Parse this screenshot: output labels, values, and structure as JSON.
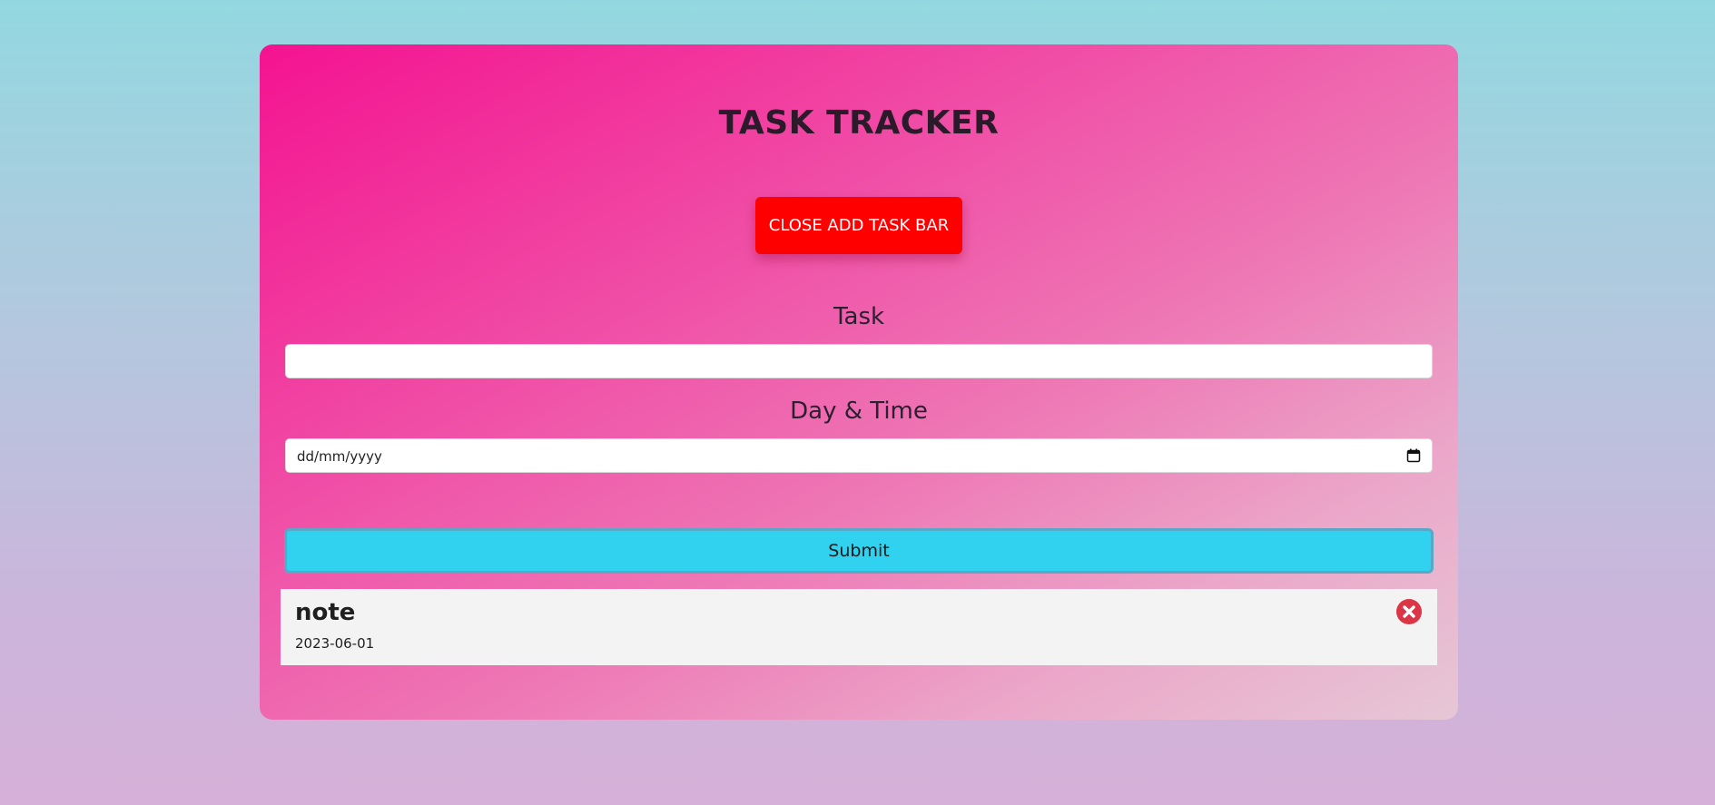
{
  "app": {
    "title": "TASK TRACKER"
  },
  "header": {
    "toggle_label": "CLOSE ADD TASK BAR"
  },
  "form": {
    "task_label": "Task",
    "task_value": "",
    "date_label": "Day & Time",
    "date_placeholder": "dd/mm/yyyy",
    "date_icon": "calendar-icon",
    "submit_label": "Submit"
  },
  "tasks": [
    {
      "name": "note",
      "date": "2023-06-01",
      "delete_icon": "close-circle-icon"
    }
  ],
  "colors": {
    "toggle_button": "#ff0000",
    "submit_button": "#30d2f0",
    "delete_icon": "#dc3545",
    "card_gradient_start": "#f41390",
    "card_gradient_end": "#e6c7d6"
  }
}
